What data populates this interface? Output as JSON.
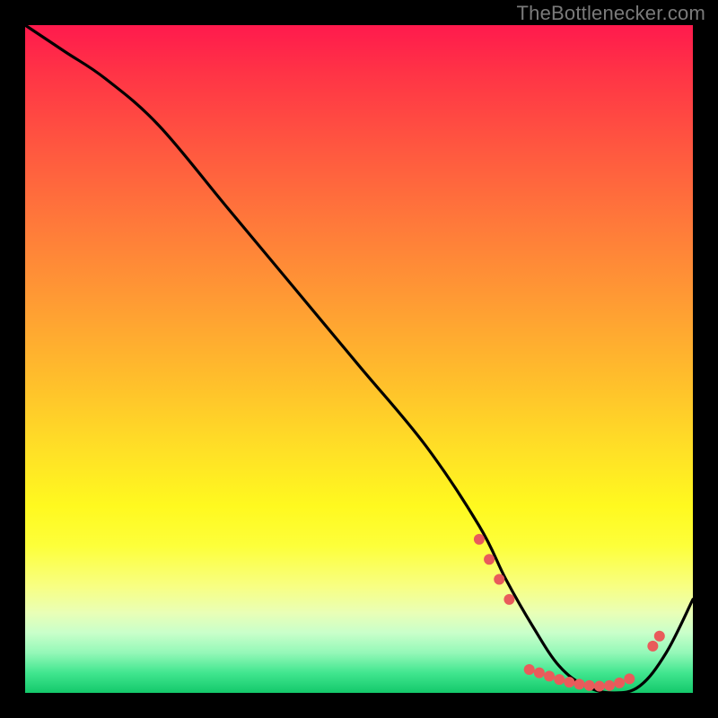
{
  "attribution": "TheBottlenecker.com",
  "chart_data": {
    "type": "line",
    "title": "",
    "xlabel": "",
    "ylabel": "",
    "xlim": [
      0,
      100
    ],
    "ylim": [
      0,
      100
    ],
    "series": [
      {
        "name": "curve",
        "x": [
          0,
          6,
          12,
          20,
          30,
          40,
          50,
          60,
          68,
          72,
          76,
          80,
          84,
          88,
          92,
          96,
          100
        ],
        "y": [
          100,
          96,
          92,
          85,
          73,
          61,
          49,
          37,
          25,
          17,
          10,
          4,
          1,
          0,
          1,
          6,
          14
        ]
      }
    ],
    "markers": {
      "name": "dots",
      "color": "#e95b5b",
      "radius": 6,
      "points": [
        {
          "x": 68.0,
          "y": 23.0
        },
        {
          "x": 69.5,
          "y": 20.0
        },
        {
          "x": 71.0,
          "y": 17.0
        },
        {
          "x": 72.5,
          "y": 14.0
        },
        {
          "x": 75.5,
          "y": 3.5
        },
        {
          "x": 77.0,
          "y": 3.0
        },
        {
          "x": 78.5,
          "y": 2.5
        },
        {
          "x": 80.0,
          "y": 2.0
        },
        {
          "x": 81.5,
          "y": 1.6
        },
        {
          "x": 83.0,
          "y": 1.3
        },
        {
          "x": 84.5,
          "y": 1.1
        },
        {
          "x": 86.0,
          "y": 1.0
        },
        {
          "x": 87.5,
          "y": 1.1
        },
        {
          "x": 89.0,
          "y": 1.5
        },
        {
          "x": 90.5,
          "y": 2.1
        },
        {
          "x": 94.0,
          "y": 7.0
        },
        {
          "x": 95.0,
          "y": 8.5
        }
      ]
    }
  }
}
